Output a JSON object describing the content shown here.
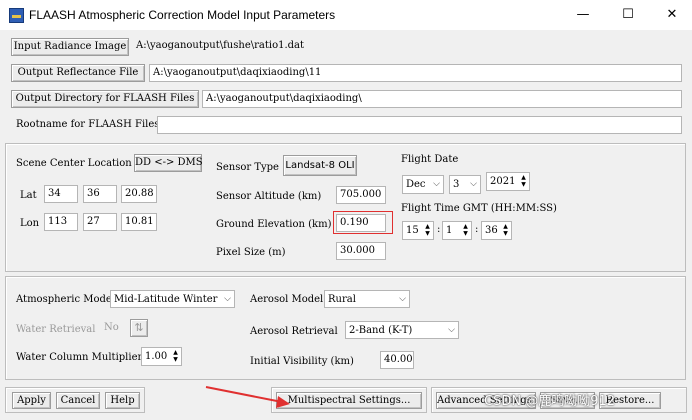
{
  "window": {
    "title": "FLAASH Atmospheric Correction Model Input Parameters",
    "minimize": "—",
    "maximize": "☐",
    "close": "✕"
  },
  "files": {
    "input_radiance_label": "Input Radiance Image",
    "input_radiance_value": "A:\\yaoganoutput\\fushe\\ratio1.dat",
    "output_reflectance_label": "Output Reflectance File",
    "output_reflectance_value": "A:\\yaoganoutput\\daqixiaoding\\11",
    "output_directory_label": "Output Directory for FLAASH Files",
    "output_directory_value": "A:\\yaoganoutput\\daqixiaoding\\",
    "rootname_label": "Rootname for FLAASH Files",
    "rootname_value": ""
  },
  "scene": {
    "center_location_label": "Scene Center Location",
    "dd_dms_button": "DD <-> DMS",
    "lat_label": "Lat",
    "lat_deg": "34",
    "lat_min": "36",
    "lat_sec": "20.88",
    "lon_label": "Lon",
    "lon_deg": "113",
    "lon_min": "27",
    "lon_sec": "10.81",
    "sensor_type_label": "Sensor Type",
    "sensor_type_value": "Landsat-8 OLI",
    "sensor_altitude_label": "Sensor Altitude (km)",
    "sensor_altitude_value": "705.000",
    "ground_elevation_label": "Ground Elevation (km)",
    "ground_elevation_value": "0.190",
    "pixel_size_label": "Pixel Size (m)",
    "pixel_size_value": "30.000",
    "flight_date_label": "Flight Date",
    "flight_month": "Dec",
    "flight_day": "3",
    "flight_year": "2021",
    "flight_time_label": "Flight Time GMT (HH:MM:SS)",
    "flight_hh": "15",
    "flight_mm": "1",
    "flight_ss": "36",
    "colon": ":"
  },
  "atmosphere": {
    "model_label": "Atmospheric Model",
    "model_value": "Mid-Latitude Winter",
    "water_retrieval_label": "Water Retrieval",
    "water_retrieval_value": "No",
    "toggle_icon": "⇅",
    "water_multiplier_label": "Water Column Multiplier",
    "water_multiplier_value": "1.00",
    "aerosol_model_label": "Aerosol Model",
    "aerosol_model_value": "Rural",
    "aerosol_retrieval_label": "Aerosol Retrieval",
    "aerosol_retrieval_value": "2-Band (K-T)",
    "initial_visibility_label": "Initial Visibility (km)",
    "initial_visibility_value": "40.00"
  },
  "buttons": {
    "apply": "Apply",
    "cancel": "Cancel",
    "help": "Help",
    "multispectral": "Multispectral Settings...",
    "advanced": "Advanced Settings...",
    "save": "Save...",
    "restore": "Restore..."
  },
  "watermark": "CSDN @鹿鸣呦呦912",
  "colors": {
    "highlight_box": "#e03030",
    "arrow": "#e03030"
  },
  "icons": {
    "dropdown": "chevron-down",
    "spin_up": "triangle-up",
    "spin_down": "triangle-down"
  }
}
